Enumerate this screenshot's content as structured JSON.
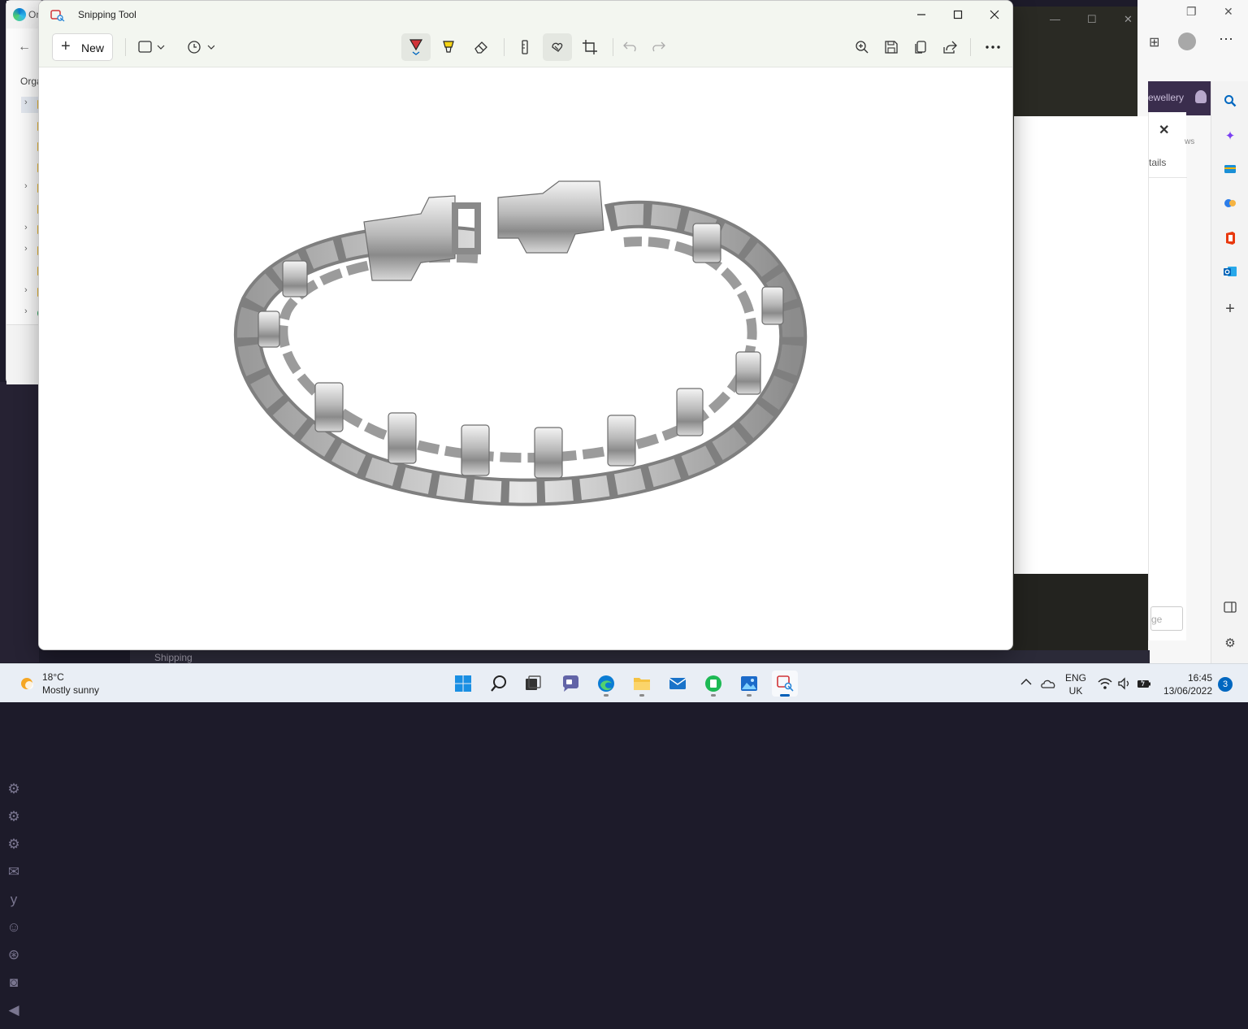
{
  "background": {
    "edge_tab_title": "Or",
    "edge_org_label": "Orga",
    "right_label_jewellery": "ewellery",
    "details_tab": "tails",
    "details_ws": "ws",
    "details_page_btn": "ge",
    "bottom_item": "Shipping"
  },
  "snip": {
    "title": "Snipping Tool",
    "new_label": "New",
    "toolbar_buttons": [
      "rectangle-mode-icon",
      "timer-icon",
      "ballpoint-pen-icon",
      "highlighter-icon",
      "eraser-icon",
      "ruler-icon",
      "touch-writing-icon",
      "crop-icon",
      "undo-icon",
      "redo-icon",
      "zoom-in-icon",
      "save-icon",
      "copy-icon",
      "share-icon",
      "more-icon"
    ]
  },
  "taskbar": {
    "temperature": "18°C",
    "weather": "Mostly sunny",
    "lang_top": "ENG",
    "lang_bottom": "UK",
    "time": "16:45",
    "date": "13/06/2022",
    "notifications": "3"
  },
  "colors": {
    "accent": "#005fb8",
    "titlebar": "#f3f6f0",
    "taskbar": "#e9eef5"
  }
}
